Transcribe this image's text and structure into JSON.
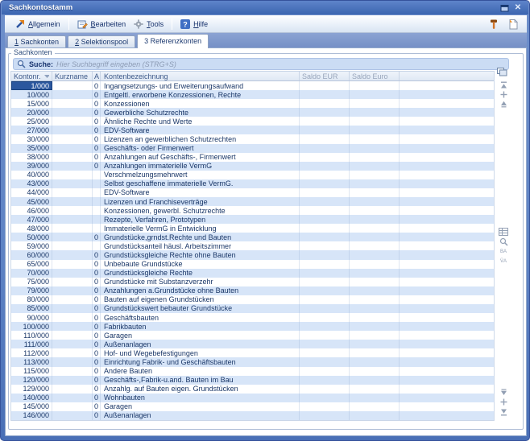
{
  "window": {
    "title": "Sachkontostamm"
  },
  "toolbar": {
    "buttons": [
      {
        "label": "Allgemein",
        "accel": "A",
        "icon": "arrow-up-right-icon"
      },
      {
        "label": "Bearbeiten",
        "accel": "B",
        "icon": "edit-note-icon"
      },
      {
        "label": "Tools",
        "accel": "T",
        "icon": "gear-icon"
      },
      {
        "label": "Hilfe",
        "accel": "H",
        "icon": "help-icon"
      }
    ]
  },
  "tabs": [
    {
      "label": "1 Sachkonten",
      "active": false
    },
    {
      "label": "2 Selektionspool",
      "active": false
    },
    {
      "label": "3 Referenzkonten",
      "active": true
    }
  ],
  "groupbox": {
    "label": "Sachkonten"
  },
  "search": {
    "label": "Suche:",
    "placeholder": "Hier Suchbegriff eingeben (STRG+S)"
  },
  "table": {
    "columns": [
      "Kontonr.",
      "Kurzname",
      "A",
      "Kontenbezeichnung",
      "Saldo EUR",
      "Saldo Euro"
    ],
    "sorted_column": "Kontonr.",
    "sort_direction": "desc",
    "selected": {
      "row": 0,
      "column": "Kontonr."
    },
    "rows": [
      [
        "1/000",
        "",
        "0",
        "Ingangsetzungs- und Erweiterungsaufwand"
      ],
      [
        "10/000",
        "",
        "0",
        "Entgeltl. erworbene Konzessionen, Rechte"
      ],
      [
        "15/000",
        "",
        "0",
        "Konzessionen"
      ],
      [
        "20/000",
        "",
        "0",
        "Gewerbliche Schutzrechte"
      ],
      [
        "25/000",
        "",
        "0",
        "Ähnliche Rechte und Werte"
      ],
      [
        "27/000",
        "",
        "0",
        "EDV-Software"
      ],
      [
        "30/000",
        "",
        "0",
        "Lizenzen an gewerblichen Schutzrechten"
      ],
      [
        "35/000",
        "",
        "0",
        "Geschäfts- oder Firmenwert"
      ],
      [
        "38/000",
        "",
        "0",
        "Anzahlungen auf Geschäfts-, Firmenwert"
      ],
      [
        "39/000",
        "",
        "0",
        "Anzahlungen immaterielle VermG"
      ],
      [
        "40/000",
        "",
        "",
        "Verschmelzungsmehrwert"
      ],
      [
        "43/000",
        "",
        "",
        "Selbst geschaffene immaterielle VermG."
      ],
      [
        "44/000",
        "",
        "",
        "EDV-Software"
      ],
      [
        "45/000",
        "",
        "",
        "Lizenzen und Franchiseverträge"
      ],
      [
        "46/000",
        "",
        "",
        "Konzessionen, gewerbl. Schutzrechte"
      ],
      [
        "47/000",
        "",
        "",
        "Rezepte, Verfahren, Prototypen"
      ],
      [
        "48/000",
        "",
        "",
        "Immaterielle VermG in Entwicklung"
      ],
      [
        "50/000",
        "",
        "0",
        "Grundstücke,grndst.Rechte und Bauten"
      ],
      [
        "59/000",
        "",
        "",
        "Grundstücksanteil häusl. Arbeitszimmer"
      ],
      [
        "60/000",
        "",
        "0",
        "Grundstücksgleiche Rechte ohne Bauten"
      ],
      [
        "65/000",
        "",
        "0",
        "Unbebaute Grundstücke"
      ],
      [
        "70/000",
        "",
        "0",
        "Grundstücksgleiche Rechte"
      ],
      [
        "75/000",
        "",
        "0",
        "Grundstücke mit Substanzverzehr"
      ],
      [
        "79/000",
        "",
        "0",
        "Anzahlungen a.Grundstücke ohne Bauten"
      ],
      [
        "80/000",
        "",
        "0",
        "Bauten auf eigenen Grundstücken"
      ],
      [
        "85/000",
        "",
        "0",
        "Grundstückswert bebauter Grundstücke"
      ],
      [
        "90/000",
        "",
        "0",
        "Geschäftsbauten"
      ],
      [
        "100/000",
        "",
        "0",
        "Fabrikbauten"
      ],
      [
        "110/000",
        "",
        "0",
        "Garagen"
      ],
      [
        "111/000",
        "",
        "0",
        "Außenanlagen"
      ],
      [
        "112/000",
        "",
        "0",
        "Hof- und Wegebefestigungen"
      ],
      [
        "113/000",
        "",
        "0",
        "Einrichtung Fabrik- und Geschäftsbauten"
      ],
      [
        "115/000",
        "",
        "0",
        "Andere Bauten"
      ],
      [
        "120/000",
        "",
        "0",
        "Geschäfts-,Fabrik-u.and. Bauten im Bau"
      ],
      [
        "129/000",
        "",
        "0",
        "Anzahlg. auf Bauten eigen. Grundstücken"
      ],
      [
        "140/000",
        "",
        "0",
        "Wohnbauten"
      ],
      [
        "145/000",
        "",
        "0",
        "Garagen"
      ],
      [
        "146/000",
        "",
        "0",
        "Außenanlagen"
      ]
    ]
  },
  "icons": {
    "close": "✕",
    "restore": "window-box",
    "search": "magnifier",
    "sort": "triangle-down",
    "nav_badges": [
      "BA",
      "VA"
    ]
  },
  "colors": {
    "titlebar_blue": "#3c66b0",
    "window_border": "#5d82c4",
    "tabstrip": "#7d98cb",
    "row_alt": "#d7e5f8",
    "row_text": "#1a3768",
    "selected_cell": "#2b579e",
    "search_fill": "#cbdcf4",
    "header_gray_text": "#98a5bb"
  }
}
